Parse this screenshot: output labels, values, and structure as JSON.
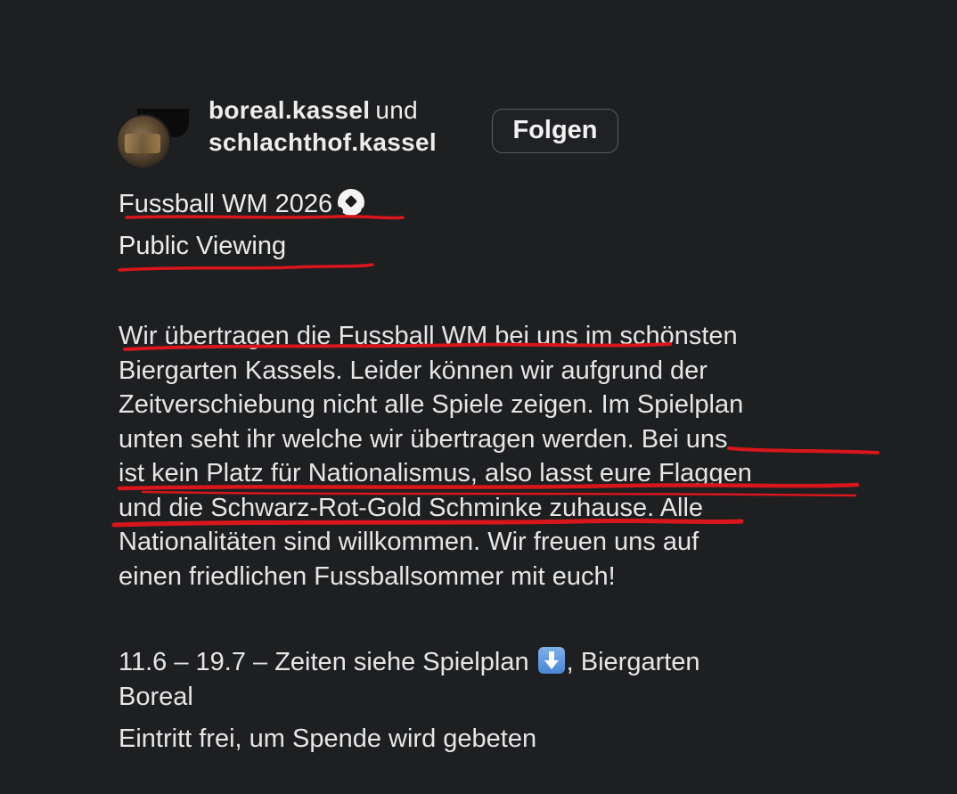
{
  "post": {
    "account_primary": "boreal.kassel",
    "account_joiner": "und",
    "account_secondary": "schlachthof.kassel",
    "follow_label": "Folgen",
    "title_line1": "Fussball WM 2026",
    "title_line2": "Public Viewing",
    "body_lines": [
      "Wir übertragen die Fussball WM bei uns im schönsten",
      "Biergarten Kassels. Leider können wir aufgrund der",
      "Zeitverschiebung nicht alle Spiele zeigen. Im Spielplan",
      "unten seht ihr welche wir übertragen werden. Bei uns",
      "ist kein Platz für Nationalismus, also lasst eure Flaggen",
      "und die Schwarz-Rot-Gold Schminke zuhause. Alle",
      "Nationalitäten sind willkommen. Wir freuen uns auf",
      "einen friedlichen Fussballsommer mit euch!"
    ],
    "schedule_line1_a": "11.6 – 19.7 – Zeiten siehe Spielplan",
    "schedule_line1_b": ", Biergarten",
    "schedule_line2": "Boreal",
    "entry_line": "Eintritt frei, um Spende wird gebeten",
    "icons": {
      "title_emoji": "soccer-ball-icon",
      "schedule_emoji": "down-arrow-icon"
    },
    "annotation_color": "#d8161b"
  }
}
